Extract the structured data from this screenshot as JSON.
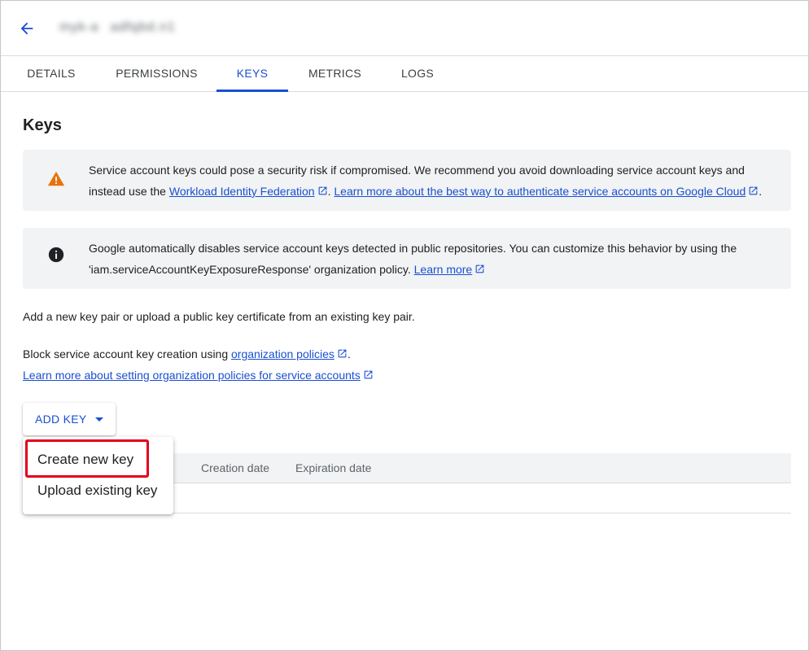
{
  "header": {
    "back_icon": "arrow-back-icon",
    "title_part1": "myk-a",
    "title_part2": "adfqbd.n1"
  },
  "tabs": [
    {
      "label": "DETAILS",
      "active": false
    },
    {
      "label": "PERMISSIONS",
      "active": false
    },
    {
      "label": "KEYS",
      "active": true
    },
    {
      "label": "METRICS",
      "active": false
    },
    {
      "label": "LOGS",
      "active": false
    }
  ],
  "page_title": "Keys",
  "warning_banner": {
    "icon": "warning-icon",
    "text_before": "Service account keys could pose a security risk if compromised. We recommend you avoid downloading service account keys and instead use the ",
    "link1": "Workload Identity Federation",
    "text_mid": ". ",
    "link2": "Learn more about the best way to authenticate service accounts on Google Cloud",
    "text_end": "."
  },
  "info_banner": {
    "icon": "info-icon",
    "text_before": "Google automatically disables service account keys detected in public repositories. You can customize this behavior by using the 'iam.serviceAccountKeyExposureResponse' organization policy. ",
    "link": "Learn more"
  },
  "intro_text": "Add a new key pair or upload a public key certificate from an existing key pair.",
  "block_text": {
    "before": "Block service account key creation using ",
    "link": "organization policies",
    "after": ".",
    "link2": "Learn more about setting organization policies for service accounts"
  },
  "add_key_button": {
    "label": "ADD KEY"
  },
  "dropdown_menu": {
    "items": [
      "Create new key",
      "Upload existing key"
    ]
  },
  "table": {
    "columns": [
      "Creation date",
      "Expiration date"
    ]
  },
  "colors": {
    "accent": "#1a4fd1",
    "warning": "#e8710a",
    "highlight": "#e3001b"
  }
}
